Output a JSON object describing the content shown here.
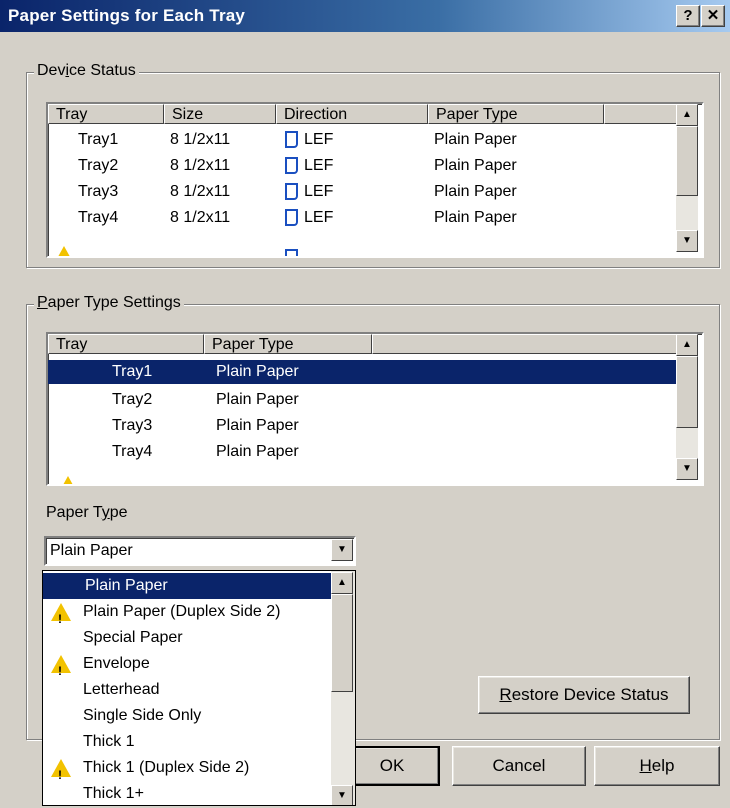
{
  "window": {
    "title": "Paper Settings for Each Tray",
    "help_label": "?",
    "close_label": "✕"
  },
  "device_status": {
    "legend_pre": "Dev",
    "legend_u": "i",
    "legend_post": "ce Status",
    "columns": [
      "Tray",
      "Size",
      "Direction",
      "Paper Type"
    ],
    "rows": [
      {
        "tray": "Tray1",
        "size": "8 1/2x11",
        "direction": "LEF",
        "paper_type": "Plain Paper"
      },
      {
        "tray": "Tray2",
        "size": "8 1/2x11",
        "direction": "LEF",
        "paper_type": "Plain Paper"
      },
      {
        "tray": "Tray3",
        "size": "8 1/2x11",
        "direction": "LEF",
        "paper_type": "Plain Paper"
      },
      {
        "tray": "Tray4",
        "size": "8 1/2x11",
        "direction": "LEF",
        "paper_type": "Plain Paper"
      }
    ]
  },
  "paper_type_settings": {
    "legend_u": "P",
    "legend_post": "aper Type Settings",
    "columns": [
      "Tray",
      "Paper Type"
    ],
    "rows": [
      {
        "tray": "Tray1",
        "paper_type": "Plain Paper",
        "selected": true
      },
      {
        "tray": "Tray2",
        "paper_type": "Plain Paper",
        "selected": false
      },
      {
        "tray": "Tray3",
        "paper_type": "Plain Paper",
        "selected": false
      },
      {
        "tray": "Tray4",
        "paper_type": "Plain Paper",
        "selected": false
      }
    ],
    "paper_type_label_pre": "Paper T",
    "paper_type_label_u": "y",
    "paper_type_label_post": "pe",
    "combo_value": "Plain Paper",
    "dropdown_options": [
      {
        "label": "Plain Paper",
        "warning": false,
        "selected": true
      },
      {
        "label": "Plain Paper (Duplex Side 2)",
        "warning": true,
        "selected": false
      },
      {
        "label": "Special Paper",
        "warning": false,
        "selected": false
      },
      {
        "label": "Envelope",
        "warning": true,
        "selected": false
      },
      {
        "label": "Letterhead",
        "warning": false,
        "selected": false
      },
      {
        "label": "Single Side Only",
        "warning": false,
        "selected": false
      },
      {
        "label": "Thick 1",
        "warning": false,
        "selected": false
      },
      {
        "label": "Thick 1 (Duplex Side 2)",
        "warning": true,
        "selected": false
      },
      {
        "label": "Thick 1+",
        "warning": false,
        "selected": false
      }
    ],
    "restore_pre": "R",
    "restore_post": "estore Device Status"
  },
  "buttons": {
    "ok": "OK",
    "cancel": "Cancel",
    "help_u": "H",
    "help_post": "elp"
  },
  "colors": {
    "selection": "#0a246a",
    "warning": "#f2c200",
    "direction_icon": "#1a4fc0"
  }
}
